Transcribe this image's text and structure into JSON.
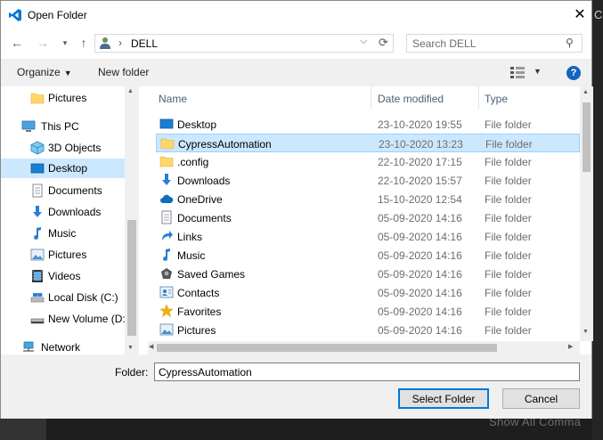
{
  "window": {
    "title": "Open Folder"
  },
  "background": {
    "corner_text": "C",
    "hint_text": "Show All Comma"
  },
  "nav": {
    "breadcrumb": "DELL",
    "search_placeholder": "Search DELL"
  },
  "toolbar": {
    "organize_label": "Organize",
    "new_folder_label": "New folder"
  },
  "sidebar": {
    "items": [
      {
        "label": "Pictures",
        "icon": "folder-icon"
      },
      {
        "label": "This PC",
        "icon": "computer-icon"
      },
      {
        "label": "3D Objects",
        "icon": "cube-icon"
      },
      {
        "label": "Desktop",
        "icon": "desktop-icon"
      },
      {
        "label": "Documents",
        "icon": "document-icon"
      },
      {
        "label": "Downloads",
        "icon": "download-icon"
      },
      {
        "label": "Music",
        "icon": "music-icon"
      },
      {
        "label": "Pictures",
        "icon": "picture-icon"
      },
      {
        "label": "Videos",
        "icon": "video-icon"
      },
      {
        "label": "Local Disk (C:)",
        "icon": "disk-icon"
      },
      {
        "label": "New Volume (D:",
        "icon": "drive-icon"
      },
      {
        "label": "Network",
        "icon": "network-icon"
      }
    ]
  },
  "columns": {
    "name": "Name",
    "date": "Date modified",
    "type": "Type"
  },
  "files": [
    {
      "name": "Desktop",
      "date": "23-10-2020 19:55",
      "type": "File folder",
      "icon": "desktop-icon"
    },
    {
      "name": "CypressAutomation",
      "date": "23-10-2020 13:23",
      "type": "File folder",
      "icon": "folder-icon"
    },
    {
      "name": ".config",
      "date": "22-10-2020 17:15",
      "type": "File folder",
      "icon": "folder-icon"
    },
    {
      "name": "Downloads",
      "date": "22-10-2020 15:57",
      "type": "File folder",
      "icon": "download-icon"
    },
    {
      "name": "OneDrive",
      "date": "15-10-2020 12:54",
      "type": "File folder",
      "icon": "cloud-icon"
    },
    {
      "name": "Documents",
      "date": "05-09-2020 14:16",
      "type": "File folder",
      "icon": "document-icon"
    },
    {
      "name": "Links",
      "date": "05-09-2020 14:16",
      "type": "File folder",
      "icon": "link-icon"
    },
    {
      "name": "Music",
      "date": "05-09-2020 14:16",
      "type": "File folder",
      "icon": "music-icon"
    },
    {
      "name": "Saved Games",
      "date": "05-09-2020 14:16",
      "type": "File folder",
      "icon": "game-icon"
    },
    {
      "name": "Contacts",
      "date": "05-09-2020 14:16",
      "type": "File folder",
      "icon": "contact-icon"
    },
    {
      "name": "Favorites",
      "date": "05-09-2020 14:16",
      "type": "File folder",
      "icon": "star-icon"
    },
    {
      "name": "Pictures",
      "date": "05-09-2020 14:16",
      "type": "File folder",
      "icon": "picture-icon"
    }
  ],
  "footer": {
    "folder_label": "Folder:",
    "folder_value": "CypressAutomation",
    "select_label": "Select Folder",
    "cancel_label": "Cancel"
  },
  "colors": {
    "accent": "#0078d7",
    "selection": "#cce8ff",
    "folder": "#ffd66b"
  }
}
